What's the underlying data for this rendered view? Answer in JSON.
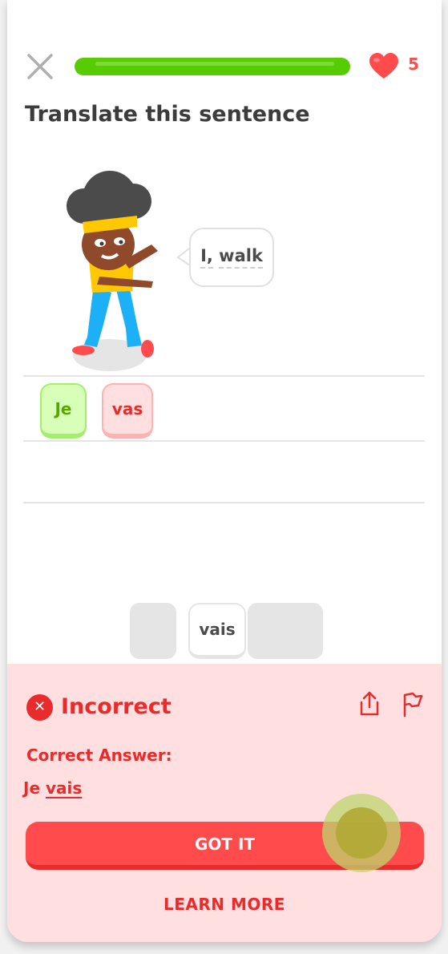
{
  "header": {
    "close_icon": "close-icon",
    "progress": 1.0,
    "hearts_count": "5",
    "heart_icon": "heart-icon"
  },
  "prompt": {
    "title": "Translate this sentence",
    "bubble_words": [
      "I,",
      "walk"
    ]
  },
  "answer_tiles": [
    "Je",
    "vas"
  ],
  "word_bank": [
    "vais"
  ],
  "feedback": {
    "status": "Incorrect",
    "correct_label": "Correct Answer:",
    "answer_prefix": "Je",
    "answer_highlight": "vais",
    "got_it_label": "GOT IT",
    "learn_more_label": "LEARN MORE",
    "share_icon": "share-icon",
    "flag_icon": "flag-icon"
  },
  "colors": {
    "correct_green": "#58cc02",
    "error_red": "#ea2b2b",
    "error_bg": "#ffdfe0"
  }
}
